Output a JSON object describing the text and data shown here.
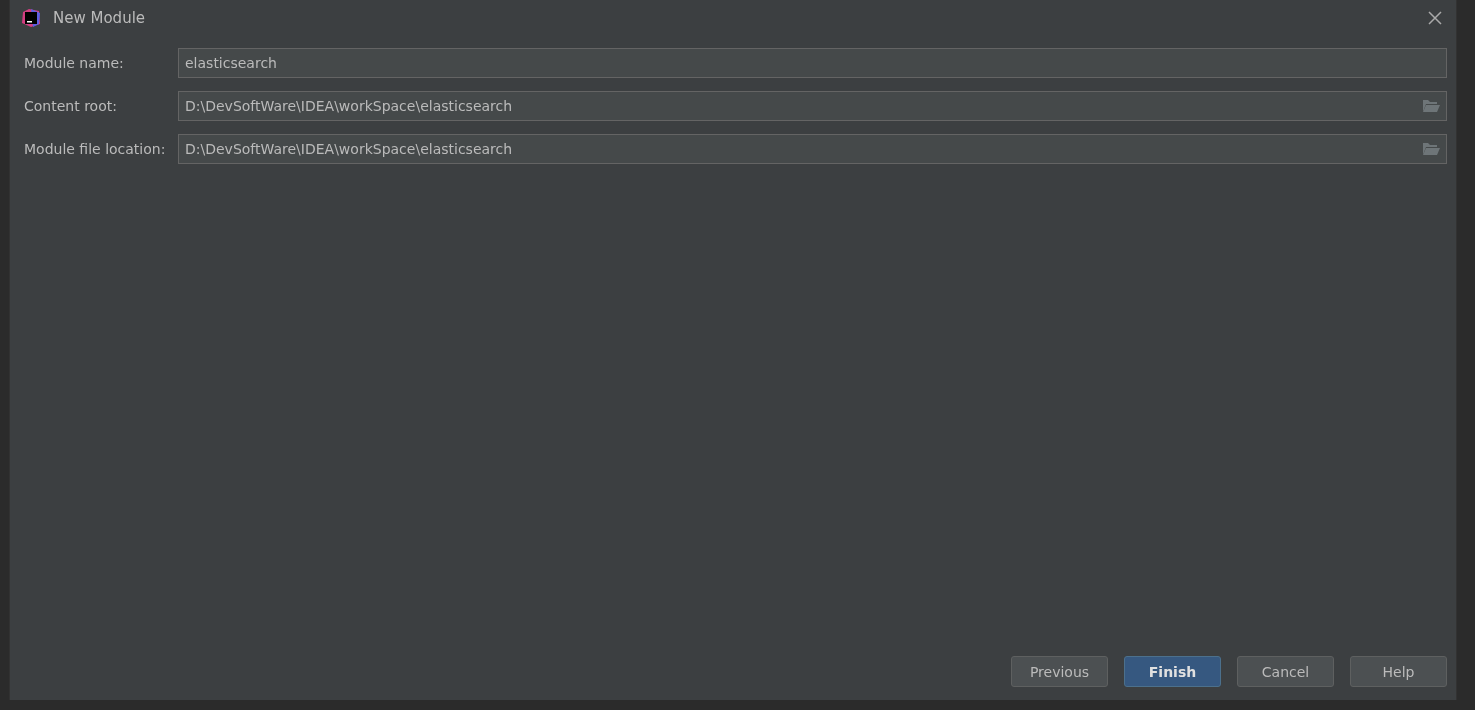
{
  "window": {
    "title": "New Module"
  },
  "fields": [
    {
      "label": "Module name:",
      "value": "elasticsearch",
      "kind": "text"
    },
    {
      "label": "Content root:",
      "value": "D:\\DevSoftWare\\IDEA\\workSpace\\elasticsearch",
      "kind": "path"
    },
    {
      "label": "Module file location:",
      "value": "D:\\DevSoftWare\\IDEA\\workSpace\\elasticsearch",
      "kind": "path"
    }
  ],
  "buttons": [
    {
      "label": "Previous",
      "primary": false
    },
    {
      "label": "Finish",
      "primary": true
    },
    {
      "label": "Cancel",
      "primary": false
    },
    {
      "label": "Help",
      "primary": false
    }
  ]
}
